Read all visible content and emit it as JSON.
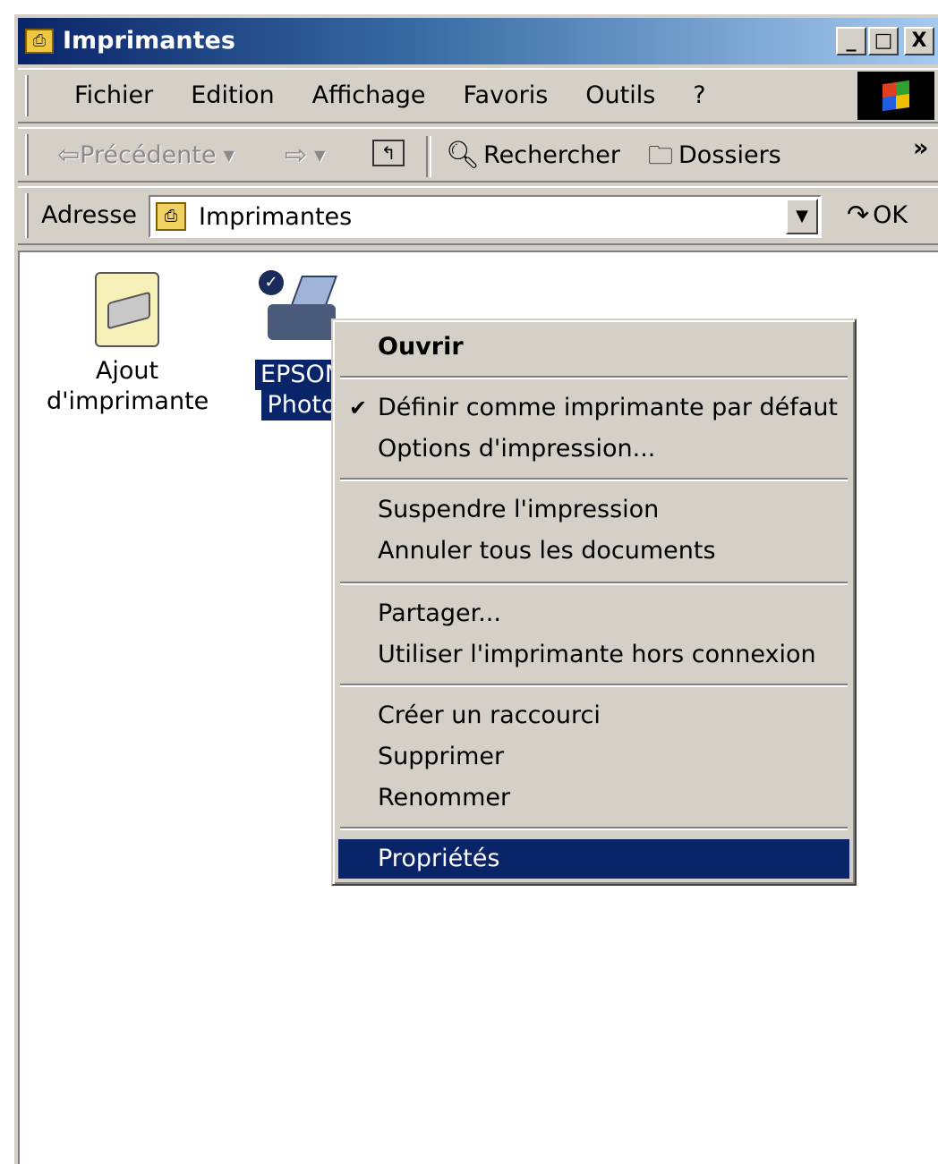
{
  "window": {
    "title": "Imprimantes",
    "caption_buttons": {
      "minimize": "_",
      "maximize": "□",
      "close": "X"
    }
  },
  "menubar": {
    "items": [
      "Fichier",
      "Edition",
      "Affichage",
      "Favoris",
      "Outils",
      "?"
    ]
  },
  "toolbar": {
    "back_label": "Précédente",
    "search_label": "Rechercher",
    "folders_label": "Dossiers",
    "more_label": "»"
  },
  "addressbar": {
    "label": "Adresse",
    "value": "Imprimantes",
    "go_label": "OK"
  },
  "content": {
    "icons": [
      {
        "label_line1": "Ajout",
        "label_line2": "d'imprimante"
      },
      {
        "label_line1": "EPSON",
        "label_line2": "Photo"
      }
    ]
  },
  "context_menu": {
    "open": "Ouvrir",
    "set_default": "Définir comme imprimante par défaut",
    "print_options": "Options d'impression...",
    "pause": "Suspendre l'impression",
    "cancel_all": "Annuler tous les documents",
    "share": "Partager...",
    "offline": "Utiliser l'imprimante hors connexion",
    "shortcut": "Créer un raccourci",
    "delete": "Supprimer",
    "rename": "Renommer",
    "properties": "Propriétés"
  }
}
